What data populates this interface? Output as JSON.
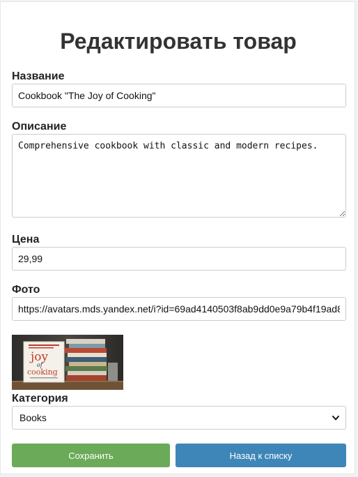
{
  "page": {
    "title": "Редактировать товар"
  },
  "form": {
    "name_label": "Название",
    "name_value": "Cookbook \"The Joy of Cooking\"",
    "description_label": "Описание",
    "description_value": "Comprehensive cookbook with classic and modern recipes.",
    "price_label": "Цена",
    "price_value": "29,99",
    "photo_label": "Фото",
    "photo_value": "https://avatars.mds.yandex.net/i?id=69ad4140503f8ab9dd0e9a79b4f19ad8",
    "photo_preview": {
      "cover_title_line1": "joy",
      "cover_title_line2": "of",
      "cover_title_line3": "cooking"
    },
    "category_label": "Категория",
    "category_selected": "Books"
  },
  "actions": {
    "save_label": "Сохранить",
    "back_label": "Назад к списку"
  },
  "colors": {
    "save_button": "#6aaa58",
    "back_button": "#3f86b8"
  },
  "icons": {
    "category_dropdown": "chevron-down-icon"
  }
}
